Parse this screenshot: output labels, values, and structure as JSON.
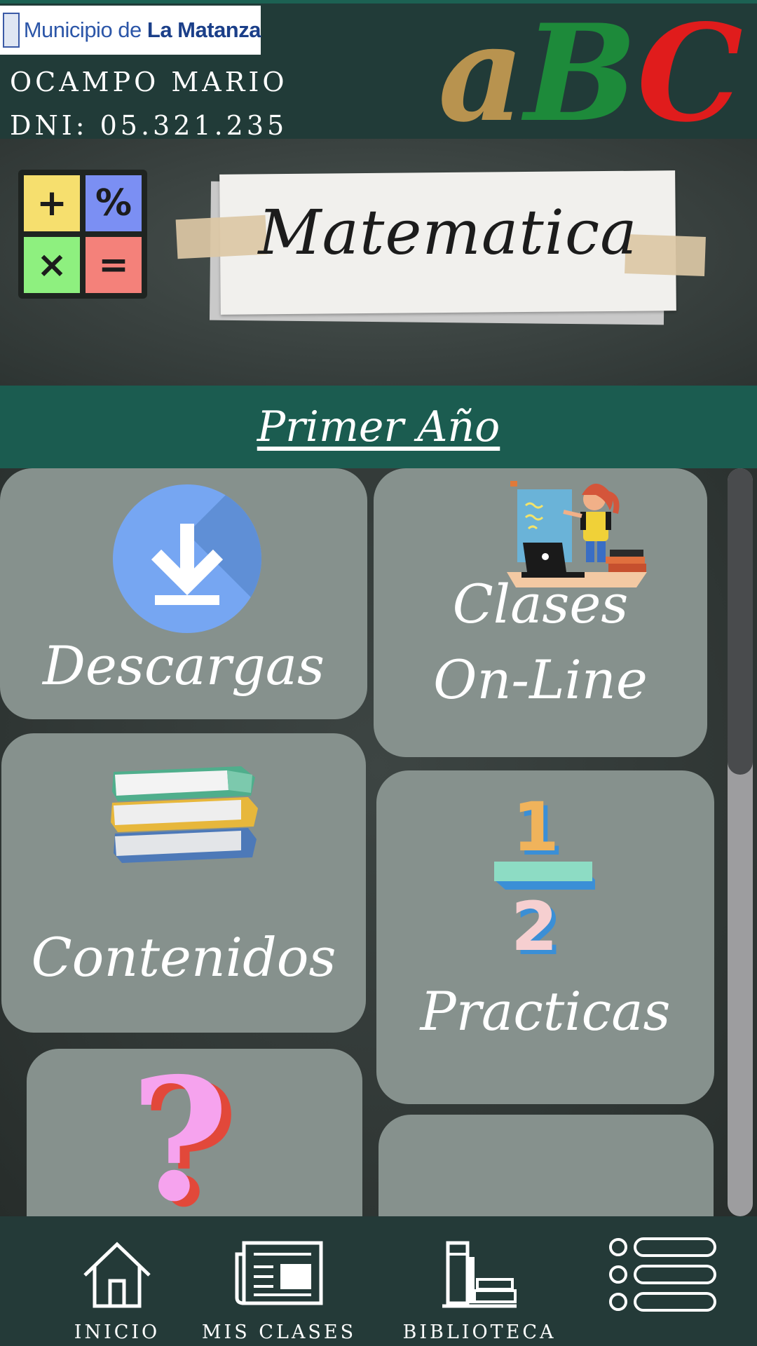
{
  "header": {
    "logo_prefix": "Municipio de ",
    "logo_bold": "La Matanza",
    "user_name": "OCAMPO MARIO",
    "user_dni": "DNI: 05.321.235",
    "abc_letters": [
      "a",
      "B",
      "C"
    ]
  },
  "banner": {
    "subject": "Matematica",
    "calculator_keys": [
      "+",
      "%",
      "×",
      "="
    ]
  },
  "year_title": "Primer Año",
  "cards": {
    "descargas": "Descargas",
    "clases_line1": "Clases",
    "clases_line2": "On-Line",
    "contenidos": "Contenidos",
    "practicas": "Practicas"
  },
  "practicas_fraction": {
    "numerator": "1",
    "denominator": "2"
  },
  "help_symbol": "?",
  "scrollbar": {
    "position_fraction": 0.0,
    "visible_fraction": 0.41
  },
  "nav": {
    "inicio": "INICIO",
    "mis_clases": "MIS CLASES",
    "biblioteca": "BIBLIOTECA"
  },
  "colors": {
    "header_bg": "#213b38",
    "accent_green": "#1b5c50",
    "card_bg": "#86918d",
    "abc_gold": "#b8934f",
    "abc_green": "#1d8a3a",
    "abc_red": "#e01c1c"
  },
  "icons": [
    "download-icon",
    "teacher-illustration",
    "books-icon",
    "fraction-icon",
    "question-mark-icon",
    "home-icon",
    "newspaper-icon",
    "library-icon",
    "menu-list-icon"
  ]
}
